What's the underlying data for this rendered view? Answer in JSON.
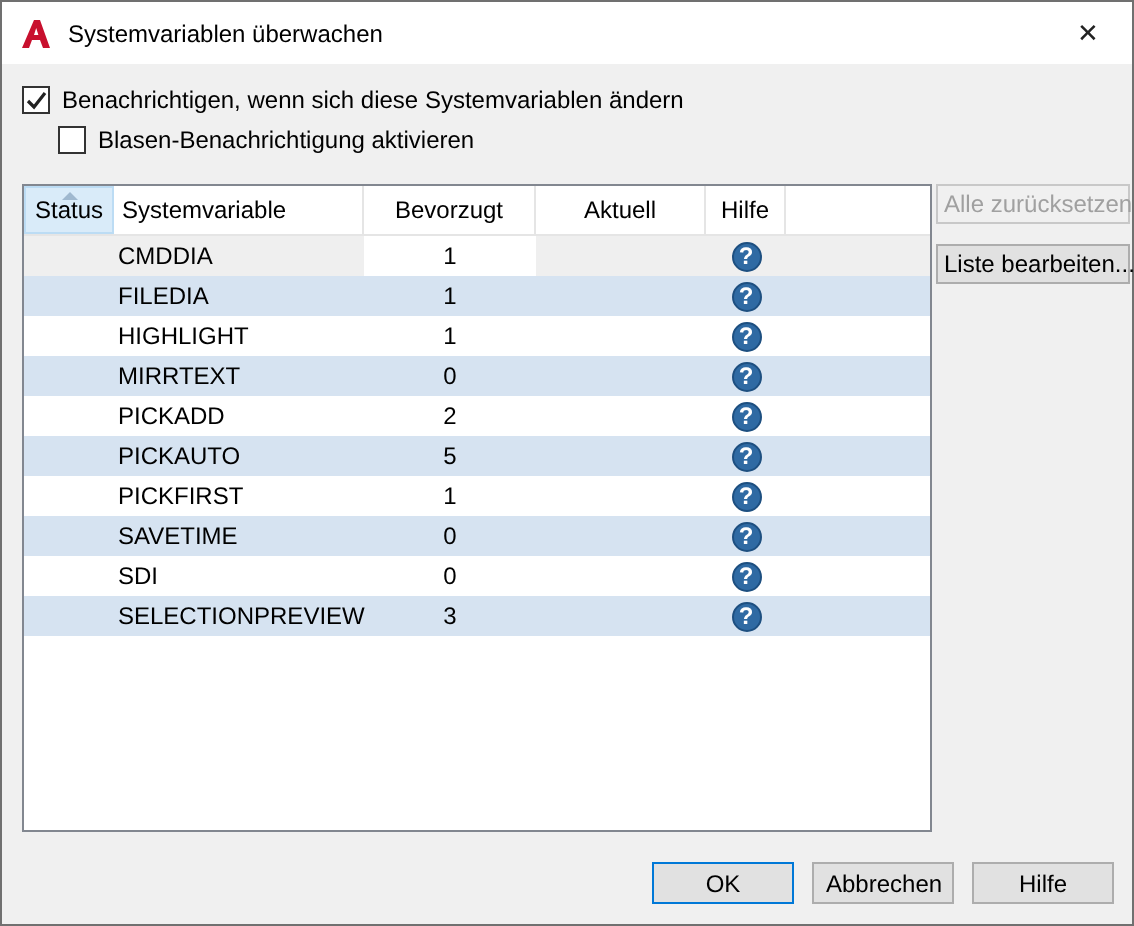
{
  "window": {
    "title": "Systemvariablen überwachen",
    "close": "✕"
  },
  "options": [
    {
      "label": "Benachrichtigen, wenn sich diese Systemvariablen ändern",
      "checked": true,
      "children": [
        {
          "label": "Blasen-Benachrichtigung aktivieren",
          "checked": false
        }
      ]
    }
  ],
  "table": {
    "columns": [
      {
        "label": "Status",
        "sorted": true
      },
      {
        "label": "Systemvariable",
        "sorted": false
      },
      {
        "label": "Bevorzugt",
        "sorted": false
      },
      {
        "label": "Aktuell",
        "sorted": false
      },
      {
        "label": "Hilfe",
        "sorted": false
      }
    ],
    "rows": [
      {
        "name": "CMDDIA",
        "preferred": "1",
        "help": "?",
        "selected": true
      },
      {
        "name": "FILEDIA",
        "preferred": "1",
        "help": "?",
        "selected": false
      },
      {
        "name": "HIGHLIGHT",
        "preferred": "1",
        "help": "?",
        "selected": false
      },
      {
        "name": "MIRRTEXT",
        "preferred": "0",
        "help": "?",
        "selected": false
      },
      {
        "name": "PICKADD",
        "preferred": "2",
        "help": "?",
        "selected": false
      },
      {
        "name": "PICKAUTO",
        "preferred": "5",
        "help": "?",
        "selected": false
      },
      {
        "name": "PICKFIRST",
        "preferred": "1",
        "help": "?",
        "selected": false
      },
      {
        "name": "SAVETIME",
        "preferred": "0",
        "help": "?",
        "selected": false
      },
      {
        "name": "SDI",
        "preferred": "0",
        "help": "?",
        "selected": false
      },
      {
        "name": "SELECTIONPREVIEW",
        "preferred": "3",
        "help": "?",
        "selected": false
      }
    ]
  },
  "side_buttons": [
    {
      "label": "Alle zurücksetzen",
      "disabled": true
    },
    {
      "label": "Liste bearbeiten...",
      "disabled": false
    }
  ],
  "buttons": [
    {
      "label": "OK",
      "default": true
    },
    {
      "label": "Abbrechen",
      "default": false
    },
    {
      "label": "Hilfe",
      "default": false
    }
  ]
}
